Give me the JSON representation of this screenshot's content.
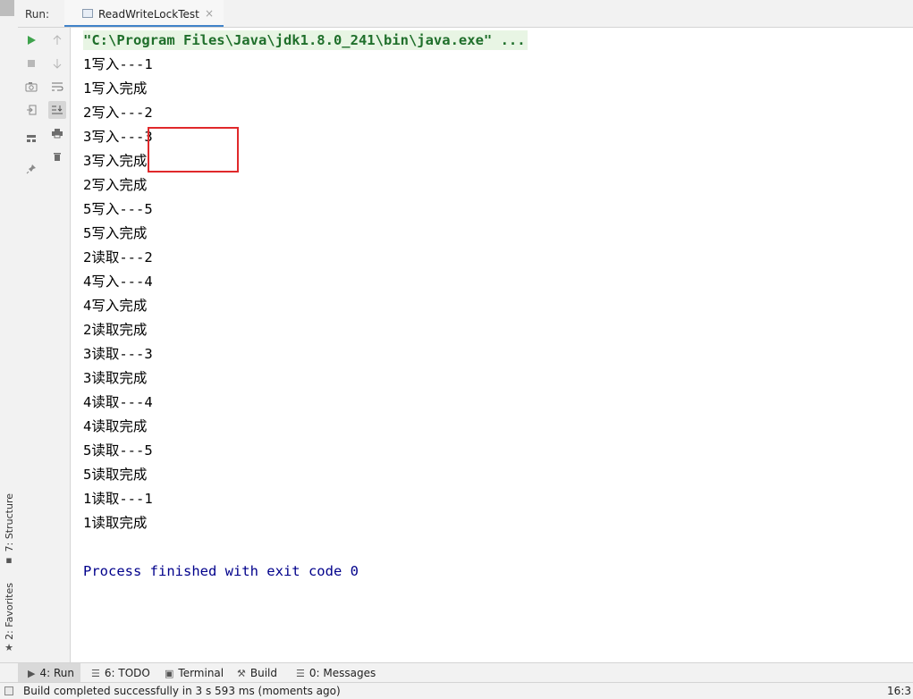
{
  "run_header": {
    "label": "Run:",
    "tab_title": "ReadWriteLockTest",
    "tab_close": "×"
  },
  "console": {
    "command": "\"C:\\Program Files\\Java\\jdk1.8.0_241\\bin\\java.exe\" ...",
    "lines": [
      "1写入---1",
      "1写入完成",
      "2写入---2",
      "3写入---3",
      "3写入完成",
      "2写入完成",
      "5写入---5",
      "5写入完成",
      "2读取---2",
      "4写入---4",
      "4写入完成",
      "2读取完成",
      "3读取---3",
      "3读取完成",
      "4读取---4",
      "4读取完成",
      "5读取---5",
      "5读取完成",
      "1读取---1",
      "1读取完成"
    ],
    "exit_message": "Process finished with exit code 0"
  },
  "toolbar_icons": {
    "rerun": "run-icon",
    "stop": "stop-icon",
    "screenshot": "camera-icon",
    "login": "exit-icon",
    "layout": "layout-icon",
    "pin": "pin-icon",
    "up": "arrow-up-icon",
    "down": "arrow-down-icon",
    "wrap": "soft-wrap-icon",
    "scroll": "scroll-to-end-icon",
    "print": "print-icon",
    "trash": "trash-icon"
  },
  "side_tabs": {
    "structure": "7: Structure",
    "favorites": "2: Favorites"
  },
  "bottom_tabs": [
    {
      "label": "4: Run",
      "icon": "run-icon"
    },
    {
      "label": "6: TODO",
      "icon": "list-icon"
    },
    {
      "label": "Terminal",
      "icon": "terminal-icon"
    },
    {
      "label": "Build",
      "icon": "hammer-icon"
    },
    {
      "label": "0: Messages",
      "icon": "messages-icon"
    }
  ],
  "status": {
    "message": "Build completed successfully in 3 s 593 ms (moments ago)",
    "position": "16:3"
  },
  "colors": {
    "command_text": "#1f6f2b",
    "command_bg": "#e8f5e4",
    "exit_text": "#00008b",
    "highlight_box": "#e0292b",
    "run_icon": "#3fa34d"
  }
}
